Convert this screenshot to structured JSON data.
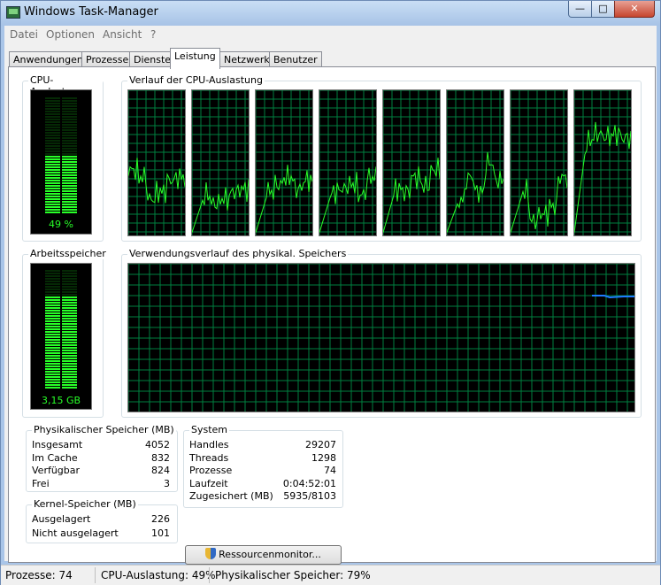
{
  "window": {
    "title": "Windows Task-Manager",
    "controls": [
      "—",
      "□",
      "✕"
    ]
  },
  "menu": [
    "Datei",
    "Optionen",
    "Ansicht",
    "?"
  ],
  "tabs": [
    {
      "label": "Anwendungen",
      "active": false
    },
    {
      "label": "Prozesse",
      "active": false
    },
    {
      "label": "Dienste",
      "active": false
    },
    {
      "label": "Leistung",
      "active": true
    },
    {
      "label": "Netzwerk",
      "active": false
    },
    {
      "label": "Benutzer",
      "active": false
    }
  ],
  "cpu": {
    "label": "CPU-Auslastung",
    "value_text": "49 %",
    "percent": 49,
    "color": "#28ff28"
  },
  "cpu_history": {
    "label": "Verlauf der CPU-Auslastung",
    "cores": 8
  },
  "memory": {
    "label": "Arbeitsspeicher",
    "value_text": "3,15 GB",
    "percent": 78
  },
  "memory_history": {
    "label": "Verwendungsverlauf des physikal. Speichers",
    "line_color": "#1e7cff"
  },
  "physical_memory": {
    "label": "Physikalischer Speicher (MB)",
    "rows": [
      {
        "key": "Insgesamt",
        "value": "4052"
      },
      {
        "key": "Im Cache",
        "value": "832"
      },
      {
        "key": "Verfügbar",
        "value": "824"
      },
      {
        "key": "Frei",
        "value": "3"
      }
    ]
  },
  "kernel_memory": {
    "label": "Kernel-Speicher (MB)",
    "rows": [
      {
        "key": "Ausgelagert",
        "value": "226"
      },
      {
        "key": "Nicht ausgelagert",
        "value": "101"
      }
    ]
  },
  "system": {
    "label": "System",
    "rows": [
      {
        "key": "Handles",
        "value": "29207"
      },
      {
        "key": "Threads",
        "value": "1298"
      },
      {
        "key": "Prozesse",
        "value": "74"
      },
      {
        "key": "Laufzeit",
        "value": "0:04:52:01"
      },
      {
        "key": "Zugesichert (MB)",
        "value": "5935/8103"
      }
    ]
  },
  "resource_monitor_button": {
    "label": "Ressourcenmonitor...",
    "icon": "uac-shield-icon"
  },
  "statusbar": {
    "processes": "Prozesse: 74",
    "cpu": "CPU-Auslastung: 49%",
    "memory": "Physikalischer Speicher: 79%"
  },
  "graph_colors": {
    "background": "#000000",
    "grid": "#008040",
    "line": "#28ff28"
  }
}
